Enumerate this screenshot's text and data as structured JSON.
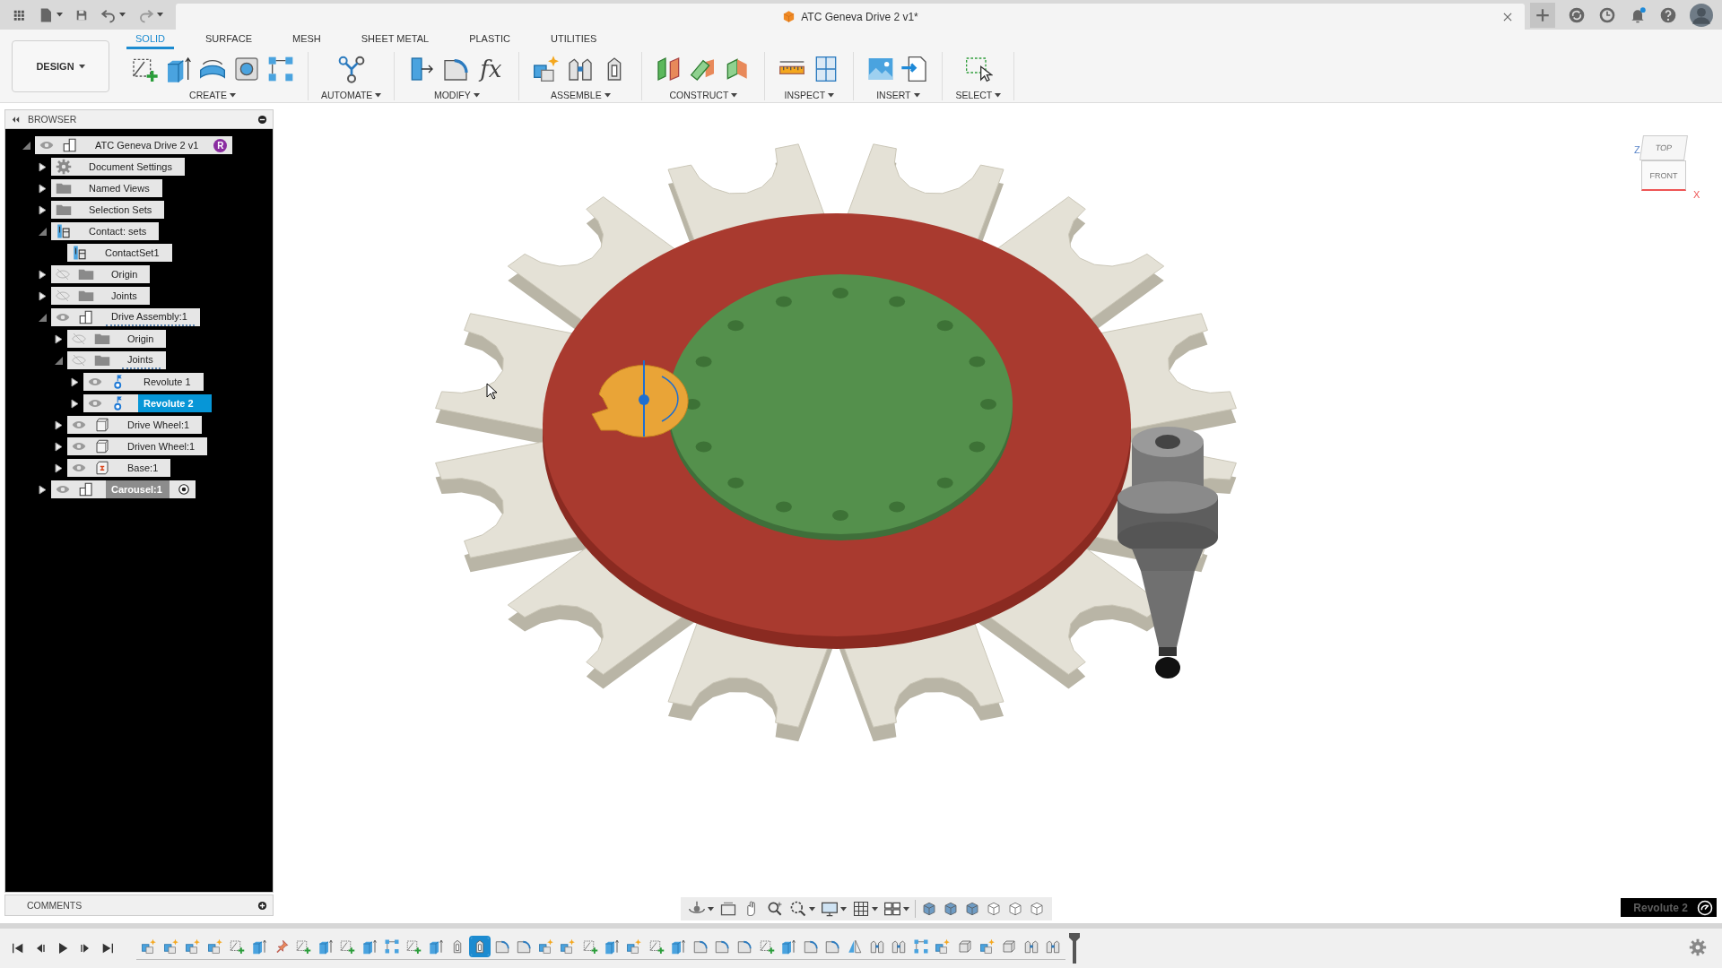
{
  "title_bar": {
    "document_title": "ATC Geneva Drive 2 v1*"
  },
  "ribbon": {
    "workspace": "DESIGN",
    "tabs": [
      {
        "label": "SOLID",
        "selected": true
      },
      {
        "label": "SURFACE",
        "selected": false
      },
      {
        "label": "MESH",
        "selected": false
      },
      {
        "label": "SHEET METAL",
        "selected": false
      },
      {
        "label": "PLASTIC",
        "selected": false
      },
      {
        "label": "UTILITIES",
        "selected": false
      }
    ],
    "groups": [
      {
        "label": "CREATE",
        "tools": [
          {
            "kind": "sketch"
          },
          {
            "kind": "extrude"
          },
          {
            "kind": "revolve"
          },
          {
            "kind": "hole"
          },
          {
            "kind": "pattern"
          }
        ]
      },
      {
        "label": "AUTOMATE",
        "tools": [
          {
            "kind": "automate"
          }
        ]
      },
      {
        "label": "MODIFY",
        "tools": [
          {
            "kind": "presspull"
          },
          {
            "kind": "fillet"
          },
          {
            "kind": "parameters",
            "glyph": "fx"
          }
        ]
      },
      {
        "label": "ASSEMBLE",
        "tools": [
          {
            "kind": "component"
          },
          {
            "kind": "joint"
          },
          {
            "kind": "jointsingle"
          }
        ]
      },
      {
        "label": "CONSTRUCT",
        "tools": [
          {
            "kind": "plane"
          },
          {
            "kind": "axis"
          },
          {
            "kind": "point"
          }
        ]
      },
      {
        "label": "INSPECT",
        "tools": [
          {
            "kind": "measure"
          },
          {
            "kind": "section"
          }
        ]
      },
      {
        "label": "INSERT",
        "tools": [
          {
            "kind": "canvas"
          },
          {
            "kind": "insert"
          }
        ]
      },
      {
        "label": "SELECT",
        "tools": [
          {
            "kind": "select"
          }
        ]
      }
    ]
  },
  "browser": {
    "title": "BROWSER",
    "tree": [
      {
        "label": "ATC Geneva Drive 2 v1",
        "kind": "assembly",
        "expanded": true,
        "visible": true,
        "badge": "R",
        "selected": false,
        "active": false,
        "dashed": false,
        "children": [
          {
            "label": "Document Settings",
            "kind": "settings",
            "expanded": false,
            "selected": false,
            "active": false,
            "dashed": false
          },
          {
            "label": "Named Views",
            "kind": "folder",
            "expanded": false,
            "selected": false,
            "active": false,
            "dashed": false
          },
          {
            "label": "Selection Sets",
            "kind": "folder",
            "expanded": false,
            "selected": false,
            "active": false,
            "dashed": false
          },
          {
            "label": "Contact: sets",
            "kind": "contact",
            "expanded": true,
            "selected": false,
            "active": false,
            "dashed": false,
            "children": [
              {
                "label": "ContactSet1",
                "kind": "contact",
                "selected": false,
                "active": false,
                "dashed": false
              }
            ]
          },
          {
            "label": "Origin",
            "kind": "folder",
            "expanded": false,
            "visible": false,
            "selected": false,
            "active": false,
            "dashed": false
          },
          {
            "label": "Joints",
            "kind": "folder",
            "expanded": false,
            "visible": false,
            "selected": false,
            "active": false,
            "dashed": false
          },
          {
            "label": "Drive Assembly:1",
            "kind": "assembly",
            "expanded": true,
            "visible": true,
            "selected": false,
            "active": false,
            "dashed": true,
            "children": [
              {
                "label": "Origin",
                "kind": "folder",
                "expanded": false,
                "visible": false,
                "selected": false,
                "active": false,
                "dashed": false
              },
              {
                "label": "Joints",
                "kind": "folder",
                "expanded": true,
                "visible": false,
                "selected": false,
                "active": false,
                "dashed": true,
                "children": [
                  {
                    "label": "Revolute 1",
                    "kind": "revolute",
                    "expanded": false,
                    "visible": true,
                    "selected": false,
                    "active": false,
                    "dashed": false
                  },
                  {
                    "label": "Revolute 2",
                    "kind": "revolute",
                    "expanded": false,
                    "visible": true,
                    "selected": true,
                    "active": false,
                    "dashed": false
                  }
                ]
              },
              {
                "label": "Drive Wheel:1",
                "kind": "body",
                "expanded": false,
                "visible": true,
                "selected": false,
                "active": false,
                "dashed": false
              },
              {
                "label": "Driven Wheel:1",
                "kind": "body",
                "expanded": false,
                "visible": true,
                "selected": false,
                "active": false,
                "dashed": false
              },
              {
                "label": "Base:1",
                "kind": "base",
                "expanded": false,
                "visible": true,
                "selected": false,
                "active": false,
                "dashed": false
              }
            ]
          },
          {
            "label": "Carousel:1",
            "kind": "assembly",
            "expanded": false,
            "visible": true,
            "selected": false,
            "active": true,
            "dashed": false
          }
        ]
      }
    ]
  },
  "comments": {
    "title": "COMMENTS"
  },
  "viewport": {
    "view_cube": {
      "top_face": "TOP",
      "front_face": "FRONT",
      "z_axis": "Z",
      "x_axis": "X"
    },
    "selection_label": "Revolute 2"
  },
  "timeline": {
    "features": [
      {
        "kind": "component",
        "selected": false
      },
      {
        "kind": "component",
        "selected": false
      },
      {
        "kind": "component",
        "selected": false
      },
      {
        "kind": "component",
        "selected": false
      },
      {
        "kind": "sketch",
        "selected": false
      },
      {
        "kind": "extrude",
        "selected": false
      },
      {
        "kind": "pin",
        "selected": false
      },
      {
        "kind": "sketch",
        "selected": false
      },
      {
        "kind": "extrude",
        "selected": false
      },
      {
        "kind": "sketch",
        "selected": false
      },
      {
        "kind": "extrude",
        "selected": false
      },
      {
        "kind": "pattern",
        "selected": false
      },
      {
        "kind": "sketch",
        "selected": false
      },
      {
        "kind": "extrude",
        "selected": false
      },
      {
        "kind": "jointsingle",
        "selected": false
      },
      {
        "kind": "jointsingle",
        "selected": true
      },
      {
        "kind": "fillet",
        "selected": false
      },
      {
        "kind": "fillet",
        "selected": false
      },
      {
        "kind": "component",
        "selected": false
      },
      {
        "kind": "component",
        "selected": false
      },
      {
        "kind": "sketch",
        "selected": false
      },
      {
        "kind": "extrude",
        "selected": false
      },
      {
        "kind": "component",
        "selected": false
      },
      {
        "kind": "sketch",
        "selected": false
      },
      {
        "kind": "extrude",
        "selected": false
      },
      {
        "kind": "fillet",
        "selected": false
      },
      {
        "kind": "fillet",
        "selected": false
      },
      {
        "kind": "fillet",
        "selected": false
      },
      {
        "kind": "sketch",
        "selected": false
      },
      {
        "kind": "extrude",
        "selected": false
      },
      {
        "kind": "fillet",
        "selected": false
      },
      {
        "kind": "fillet",
        "selected": false
      },
      {
        "kind": "mirror",
        "selected": false
      },
      {
        "kind": "joint",
        "selected": false
      },
      {
        "kind": "joint",
        "selected": false
      },
      {
        "kind": "pattern",
        "selected": false
      },
      {
        "kind": "component",
        "selected": false
      },
      {
        "kind": "body",
        "selected": false
      },
      {
        "kind": "component",
        "selected": false
      },
      {
        "kind": "body",
        "selected": false
      },
      {
        "kind": "joint",
        "selected": false
      },
      {
        "kind": "joint",
        "selected": false
      }
    ]
  }
}
